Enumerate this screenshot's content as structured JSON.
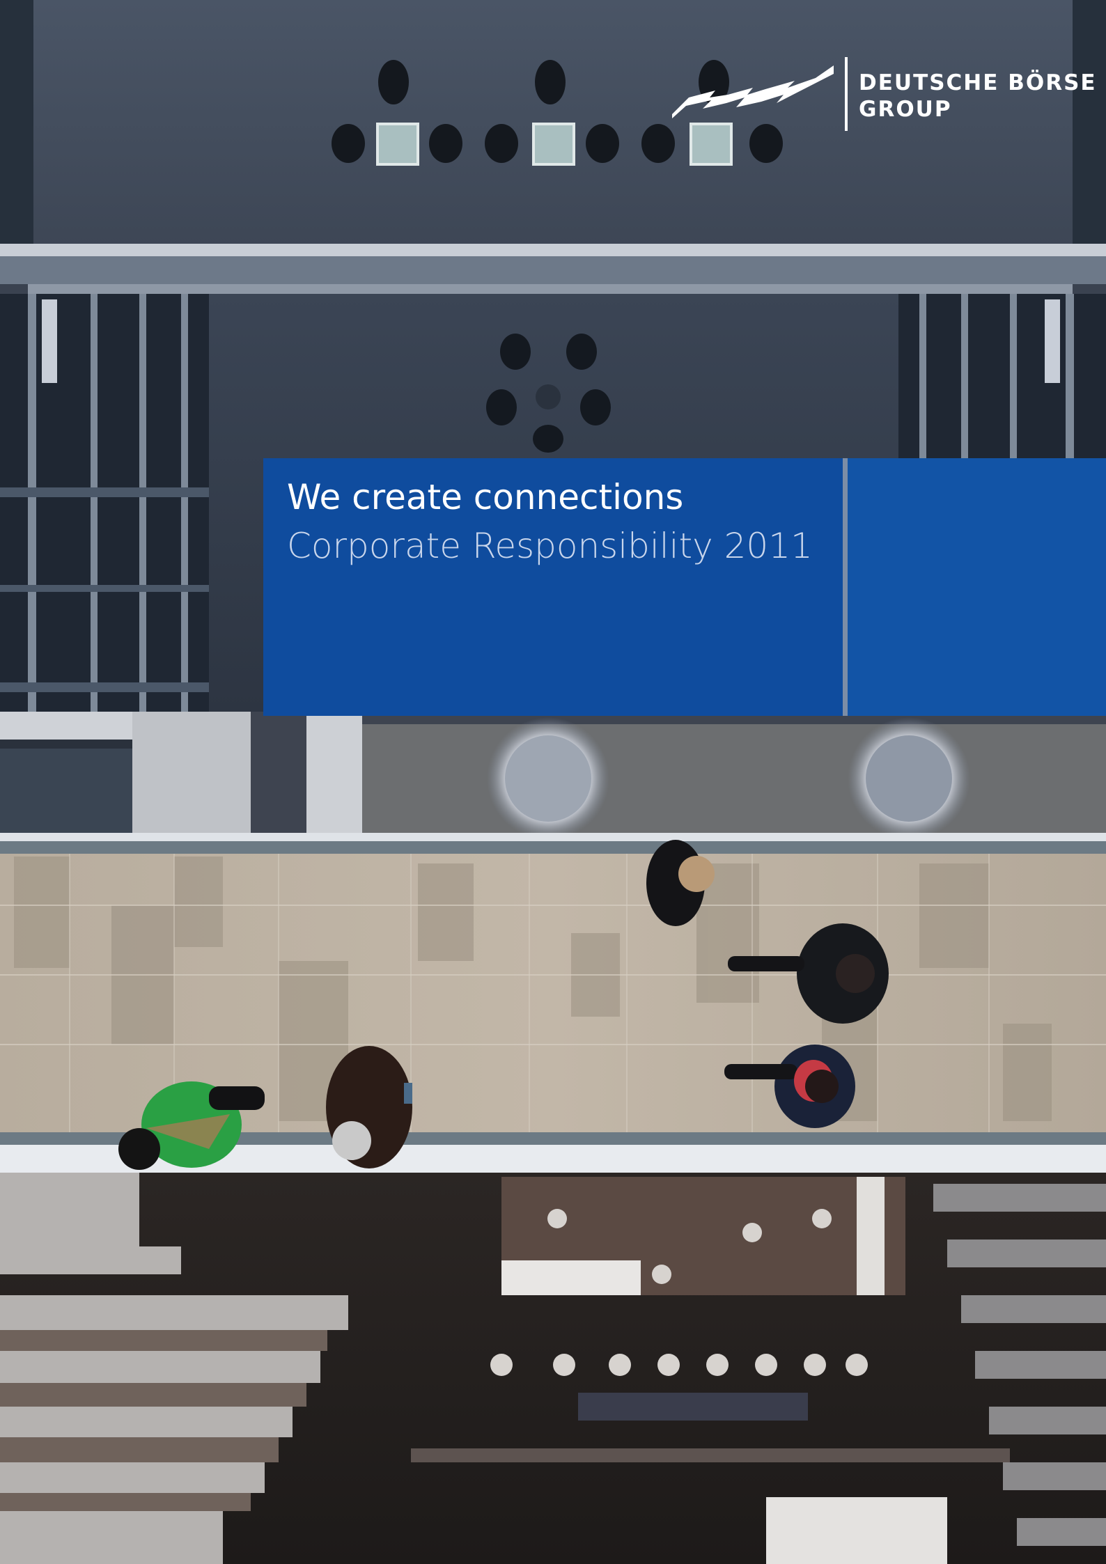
{
  "logo": {
    "line1": "DEUTSCHE BÖRSE",
    "line2": "GROUP"
  },
  "title": {
    "headline": "We create connections",
    "subtitle": "Corporate Responsibility 2011"
  },
  "colors": {
    "panel_blue": "#0f4c9e",
    "panel_blue_right": "#1254a6",
    "subtitle_text": "#c9d6ec",
    "logo_white": "#ffffff"
  }
}
